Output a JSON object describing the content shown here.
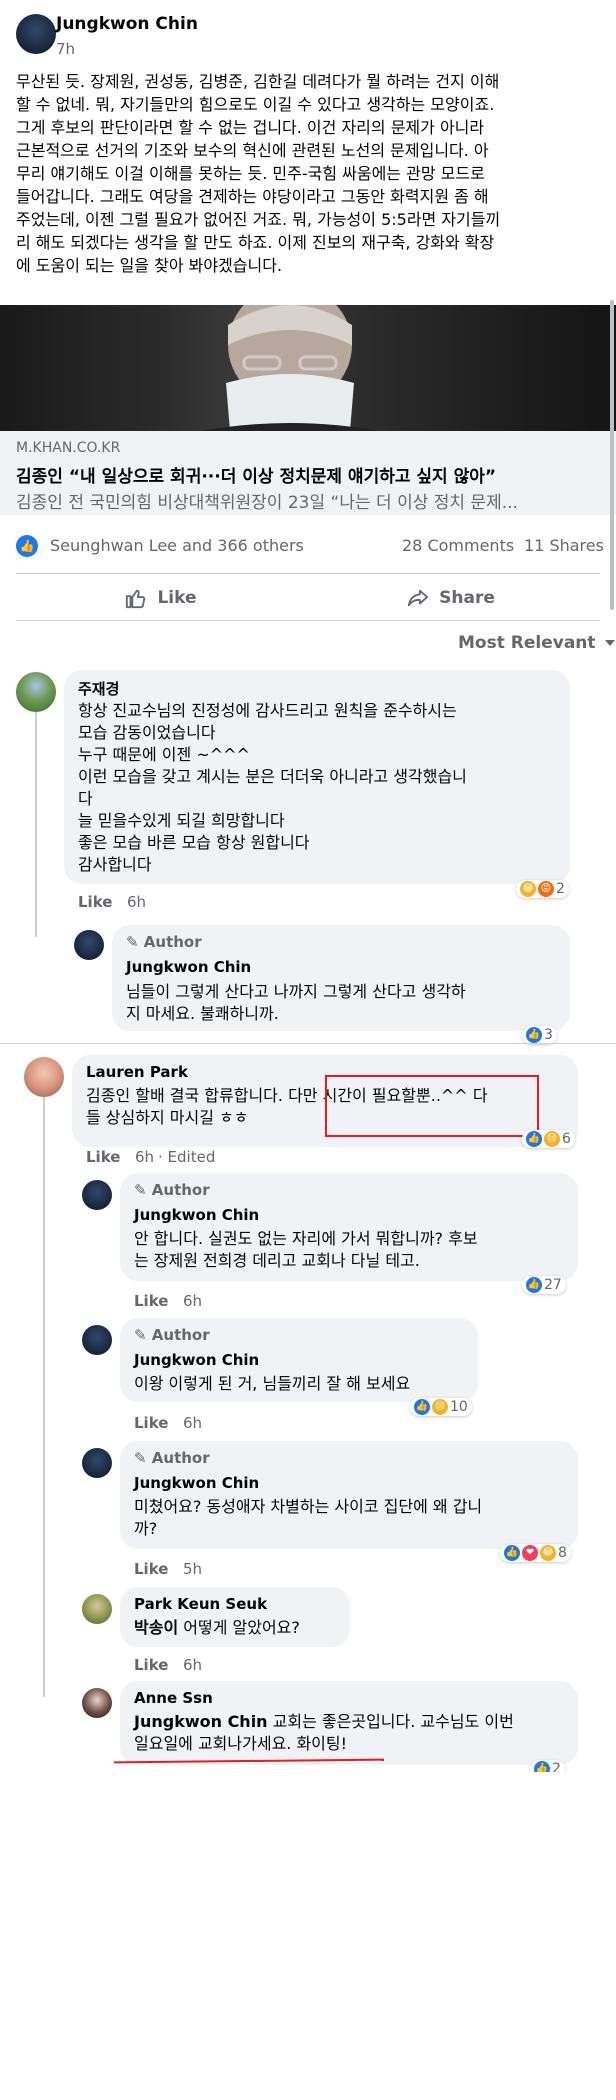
{
  "post": {
    "author": "Jungkwon Chin",
    "time": "7h",
    "text_lines": [
      "무산된 듯. 장제원, 권성동, 김병준, 김한길 데려다가 뭘 하려는 건지 이해",
      "할 수 없네. 뭐, 자기들만의 힘으로도 이길 수 있다고 생각하는 모양이죠.",
      "그게 후보의 판단이라면 할 수 없는 겁니다. 이건 자리의 문제가 아니라",
      "근본적으로 선거의 기조와 보수의 혁신에 관련된 노선의 문제입니다. 아",
      "무리 얘기해도 이걸 이해를 못하는 듯. 민주-국힘 싸움에는 관망 모드로",
      "들어갑니다. 그래도 여당을 견제하는 야당이라고 그동안 화력지원 좀 해",
      "주었는데, 이젠 그럴 필요가 없어진 거죠. 뭐, 가능성이 5:5라면 자기들끼",
      "리 해도 되겠다는 생각을 할 만도 하죠. 이제 진보의 재구축, 강화와 확장",
      "에 도움이 되는 일을 찾아 봐야겠습니다."
    ]
  },
  "link": {
    "domain": "M.KHAN.CO.KR",
    "title": "김종인 “내 일상으로 회귀···더 이상 정치문제 얘기하고 싶지 않아”",
    "description": "김종인 전 국민의힘 비상대책위원장이 23일 “나는 더 이상 정치 문제..."
  },
  "stats": {
    "reactions": "Seunghwan Lee and 366 others",
    "comments": "28 Comments",
    "shares": "11 Shares"
  },
  "actions": {
    "like": "Like",
    "share": "Share"
  },
  "sort": {
    "label": "Most Relevant"
  },
  "author_badge": "Author",
  "like_label": "Like",
  "comments": [
    {
      "name": "주재경",
      "lines": [
        "항상 진교수님의 진정성에 감사드리고 원칙을 준수하시는",
        "모습 감동이었습니다",
        "누구 때문에 이젠 ~^^^",
        "이런 모습을 갖고 계시는 분은 더더욱 아니라고 생각했습니",
        "다",
        "늘 믿을수있게 되길 희망합니다",
        "좋은 모습 바른 모습 항상 원합니다",
        "감사합니다"
      ],
      "age": "6h",
      "react_count": "2"
    },
    {
      "name": "Jungkwon Chin",
      "lines": [
        "님들이 그렇게 산다고 나까지 그렇게 산다고 생각하",
        "지 마세요. 불쾌하니까."
      ],
      "react_count": "3"
    },
    {
      "name": "Lauren Park",
      "line1a": "김종인 할배 결국 합류합니다.",
      "line1b": "다만 시간이 필요할뿐..^^",
      "line1c": "다",
      "line2": "들 상심하지 마시길 ㅎㅎ",
      "age": "6h",
      "edited": "Edited",
      "react_count": "6"
    },
    {
      "name": "Jungkwon Chin",
      "lines": [
        "안 합니다. 실권도 없는 자리에 가서 뭐합니까? 후보",
        "는 장제원 전희경 데리고 교회나 다닐 테고."
      ],
      "age": "6h",
      "react_count": "27"
    },
    {
      "name": "Jungkwon Chin",
      "lines": [
        "이왕 이렇게 된 거, 님들끼리 잘 해 보세요"
      ],
      "age": "6h",
      "react_count": "10"
    },
    {
      "name": "Jungkwon Chin",
      "lines": [
        "미쳤어요? 동성애자 차별하는 사이코 집단에 왜 갑니",
        "까?"
      ],
      "age": "5h",
      "react_count": "8"
    },
    {
      "name": "Park Keun Seuk",
      "tag": "박송이",
      "text": " 어떻게 알았어요?",
      "age": "6h"
    },
    {
      "name": "Anne Ssn",
      "tag": "Jungkwon Chin",
      "text": " 교회는 좋은곳입니다. 교수님도 이번",
      "line2": "일요일에 교회나가세요. 화이팅!",
      "react_count": "2"
    }
  ],
  "colors": {
    "blue": "#1877f2",
    "red": "#e41e1e",
    "grey": "#65676b",
    "bubble": "#f0f2f5"
  }
}
